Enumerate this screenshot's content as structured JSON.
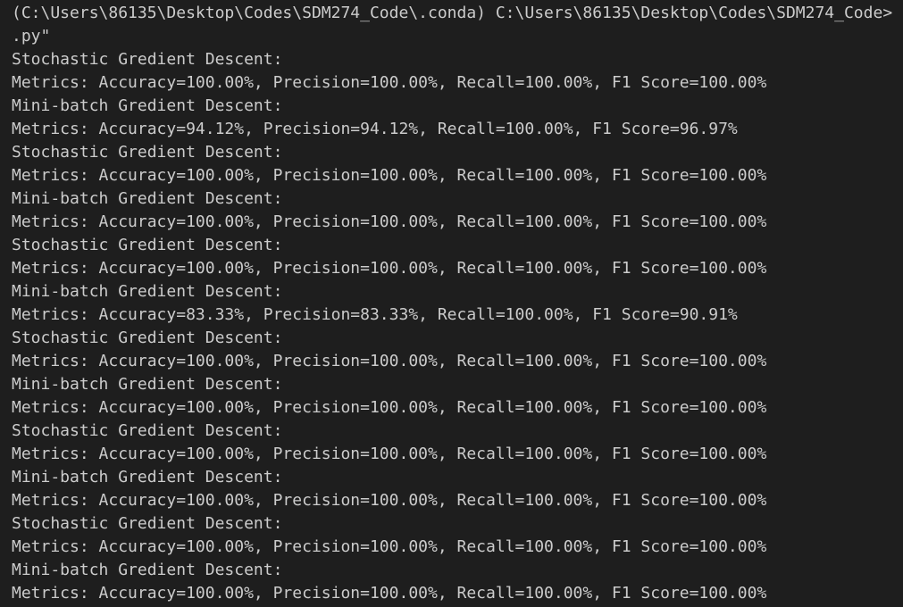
{
  "terminal": {
    "prompt_line": "(C:\\Users\\86135\\Desktop\\Codes\\SDM274_Code\\.conda) C:\\Users\\86135\\Desktop\\Codes\\SDM274_Code>",
    "command_tail": ".py\"",
    "output": [
      "Stochastic Gredient Descent:",
      "Metrics: Accuracy=100.00%, Precision=100.00%, Recall=100.00%, F1 Score=100.00%",
      "Mini-batch Gredient Descent:",
      "Metrics: Accuracy=94.12%, Precision=94.12%, Recall=100.00%, F1 Score=96.97%",
      "Stochastic Gredient Descent:",
      "Metrics: Accuracy=100.00%, Precision=100.00%, Recall=100.00%, F1 Score=100.00%",
      "Mini-batch Gredient Descent:",
      "Metrics: Accuracy=100.00%, Precision=100.00%, Recall=100.00%, F1 Score=100.00%",
      "Stochastic Gredient Descent:",
      "Metrics: Accuracy=100.00%, Precision=100.00%, Recall=100.00%, F1 Score=100.00%",
      "Mini-batch Gredient Descent:",
      "Metrics: Accuracy=83.33%, Precision=83.33%, Recall=100.00%, F1 Score=90.91%",
      "Stochastic Gredient Descent:",
      "Metrics: Accuracy=100.00%, Precision=100.00%, Recall=100.00%, F1 Score=100.00%",
      "Mini-batch Gredient Descent:",
      "Metrics: Accuracy=100.00%, Precision=100.00%, Recall=100.00%, F1 Score=100.00%",
      "Stochastic Gredient Descent:",
      "Metrics: Accuracy=100.00%, Precision=100.00%, Recall=100.00%, F1 Score=100.00%",
      "Mini-batch Gredient Descent:",
      "Metrics: Accuracy=100.00%, Precision=100.00%, Recall=100.00%, F1 Score=100.00%",
      "Stochastic Gredient Descent:",
      "Metrics: Accuracy=100.00%, Precision=100.00%, Recall=100.00%, F1 Score=100.00%",
      "Mini-batch Gredient Descent:",
      "Metrics: Accuracy=100.00%, Precision=100.00%, Recall=100.00%, F1 Score=100.00%"
    ]
  },
  "colors": {
    "background": "#1e1e1e",
    "text": "#cccccc"
  }
}
